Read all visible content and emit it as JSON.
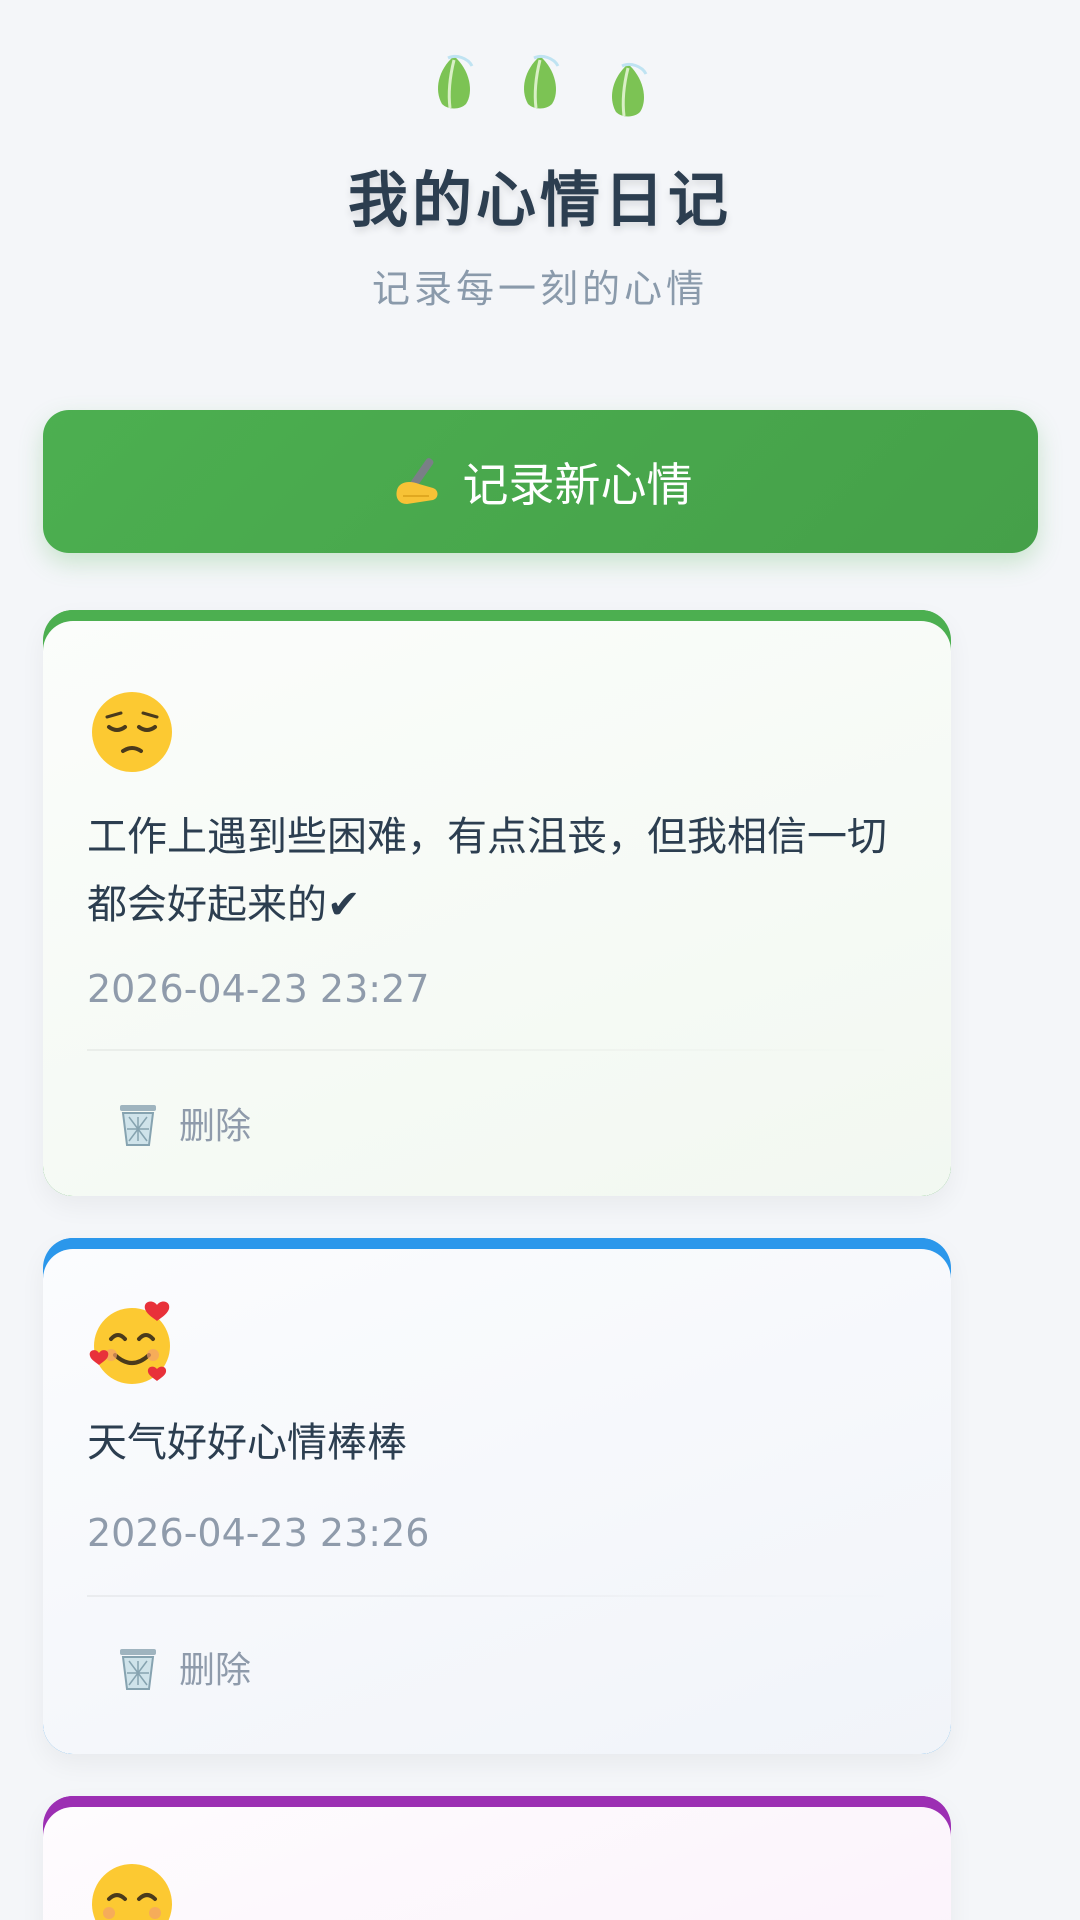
{
  "header": {
    "title": "我的心情日记",
    "subtitle": "记录每一刻的心情",
    "decor_icon": "leaf-icon"
  },
  "add_button": {
    "icon": "writing-hand-icon",
    "label": "记录新心情",
    "color": "#4caf50"
  },
  "entries": [
    {
      "emoji": "pensive-face-icon",
      "text": "工作上遇到些困难，有点沮丧，但我相信一切都会好起来的✔",
      "date": "2026-04-23 23:27",
      "delete_label": "删除",
      "accent": "#4caf50"
    },
    {
      "emoji": "smiling-face-with-hearts-icon",
      "text": "天气好好心情棒棒",
      "date": "2026-04-23 23:26",
      "delete_label": "删除",
      "accent": "#2b97eb"
    },
    {
      "emoji": "smiling-face-icon",
      "accent": "#9c2fb3"
    }
  ]
}
